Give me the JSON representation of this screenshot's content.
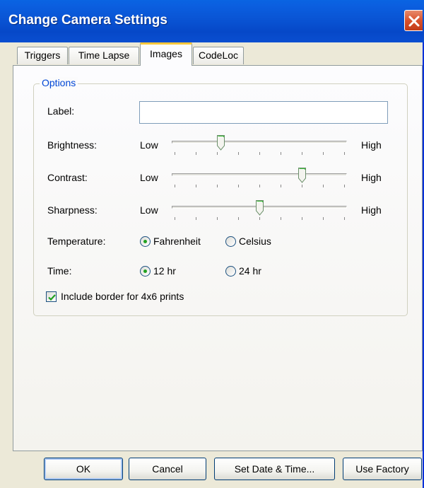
{
  "window": {
    "title": "Change Camera Settings"
  },
  "tabs": [
    {
      "label": "Triggers",
      "active": false
    },
    {
      "label": "Time Lapse",
      "active": false
    },
    {
      "label": "Images",
      "active": true
    },
    {
      "label": "CodeLoc",
      "active": false
    }
  ],
  "options": {
    "legend": "Options",
    "label_caption": "Label:",
    "label_value": "",
    "brightness": {
      "caption": "Brightness:",
      "low": "Low",
      "high": "High",
      "value": 0.27
    },
    "contrast": {
      "caption": "Contrast:",
      "low": "Low",
      "high": "High",
      "value": 0.75
    },
    "sharpness": {
      "caption": "Sharpness:",
      "low": "Low",
      "high": "High",
      "value": 0.5
    },
    "temperature": {
      "caption": "Temperature:",
      "options": [
        "Fahrenheit",
        "Celsius"
      ],
      "selected": "Fahrenheit"
    },
    "time": {
      "caption": "Time:",
      "options": [
        "12 hr",
        "24 hr"
      ],
      "selected": "12 hr"
    },
    "border_checkbox": {
      "label": "Include border for 4x6 prints",
      "checked": true
    }
  },
  "buttons": {
    "ok": "OK",
    "cancel": "Cancel",
    "set_date_time": "Set Date & Time...",
    "use_factory": "Use Factory"
  },
  "colors": {
    "titlebar": "#0a56d6",
    "accent_tab": "#ffc83c",
    "radio_dot": "#21a121",
    "close": "#d9512c"
  }
}
